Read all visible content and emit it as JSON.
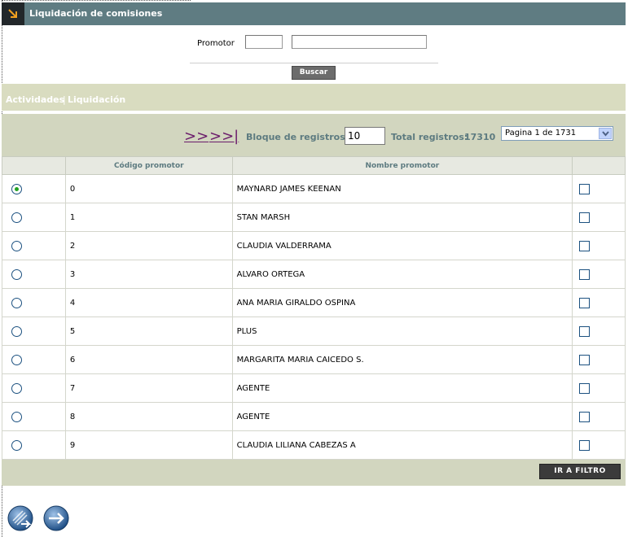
{
  "header": {
    "title": "Liquidación de comisiones"
  },
  "search": {
    "label": "Promotor",
    "code_value": "",
    "name_value": "",
    "button_label": "Buscar"
  },
  "tabs": [
    {
      "label": "Actividades"
    },
    {
      "label": "Liquidación"
    }
  ],
  "tabs_separator": "|",
  "pager": {
    "next_label": ">>",
    "last_label": ">>|",
    "block_label": "Bloque de registros:",
    "block_value": "10",
    "total_label": "Total registros:",
    "total_value": "17310",
    "page_selected": "Pagina 1 de 1731"
  },
  "table": {
    "columns": [
      "",
      "Código promotor",
      "Nombre promotor",
      ""
    ],
    "rows": [
      {
        "code": "0",
        "name": "MAYNARD JAMES KEENAN",
        "selected": true
      },
      {
        "code": "1",
        "name": "STAN MARSH",
        "selected": false
      },
      {
        "code": "2",
        "name": "CLAUDIA VALDERRAMA",
        "selected": false
      },
      {
        "code": "3",
        "name": "ALVARO ORTEGA",
        "selected": false
      },
      {
        "code": "4",
        "name": "ANA MARIA GIRALDO OSPINA",
        "selected": false
      },
      {
        "code": "5",
        "name": "PLUS",
        "selected": false
      },
      {
        "code": "6",
        "name": "MARGARITA MARIA CAICEDO S.",
        "selected": false
      },
      {
        "code": "7",
        "name": "AGENTE",
        "selected": false
      },
      {
        "code": "8",
        "name": "AGENTE",
        "selected": false
      },
      {
        "code": "9",
        "name": "CLAUDIA LILIANA CABEZAS A",
        "selected": false
      }
    ]
  },
  "filter_button_label": "IR A FILTRO",
  "icons": {
    "header": "arrow-corner-icon",
    "bottom_left": "exit-icon",
    "bottom_right": "forward-icon"
  },
  "colors": {
    "header_bg": "#5f7c82",
    "tab_bar_bg": "#d9dcc0",
    "panel_bg": "#d2d6bf",
    "label_text": "#5d7b80"
  }
}
